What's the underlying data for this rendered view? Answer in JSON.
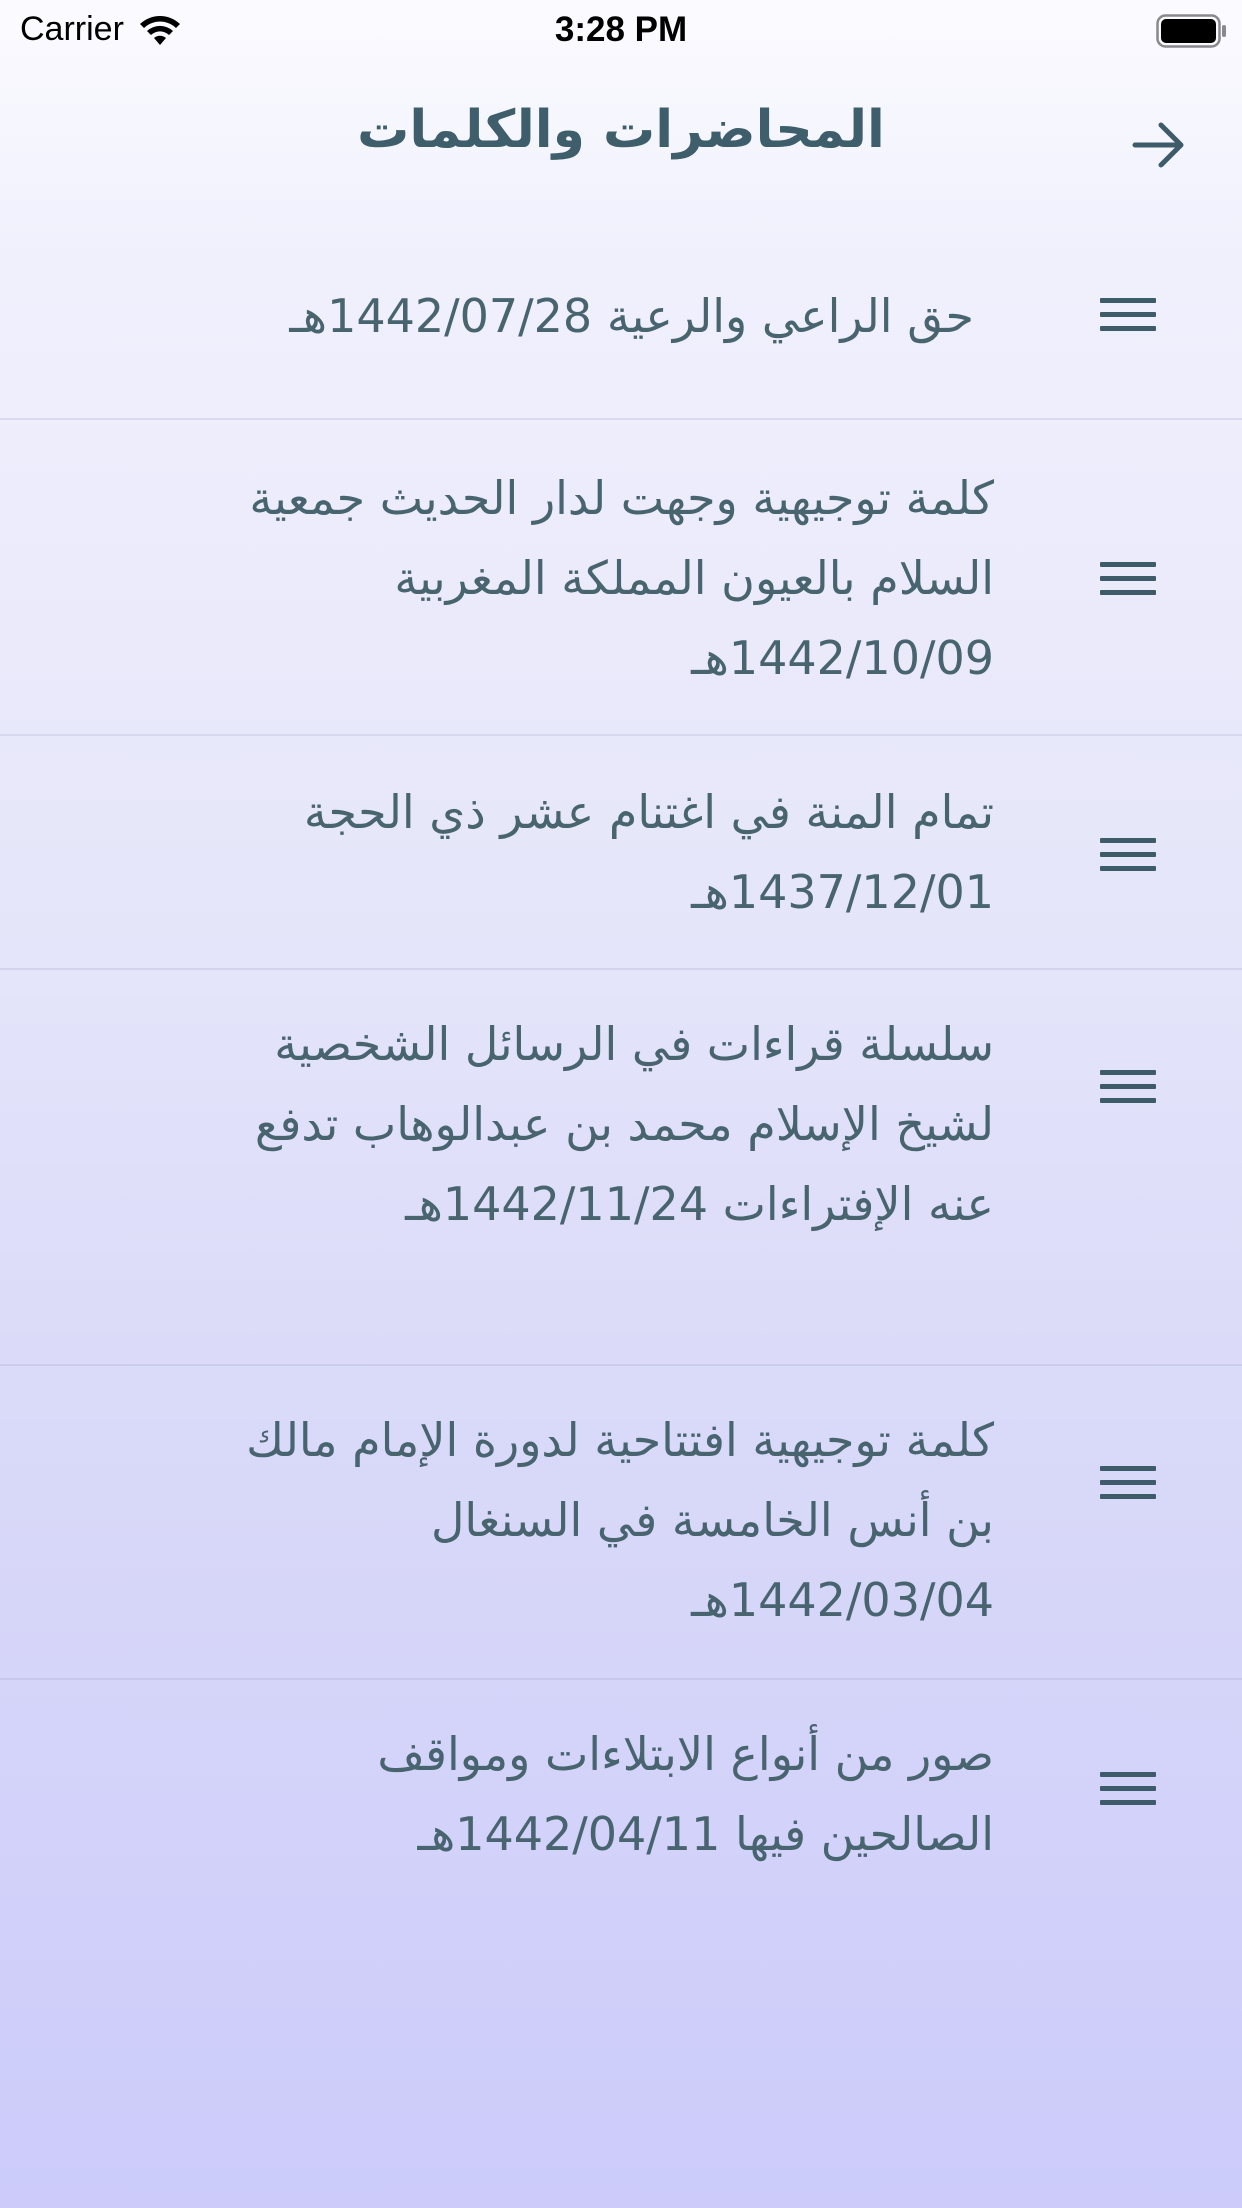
{
  "status_bar": {
    "carrier": "Carrier",
    "time": "3:28 PM",
    "icons": [
      "wifi-icon",
      "battery-icon"
    ]
  },
  "nav": {
    "title": "المحاضرات والكلمات",
    "back_icon": "arrow-right-icon"
  },
  "lectures": [
    {
      "title": "حق الراعي والرعية 1442/07/28هـ",
      "icon": "menu-icon"
    },
    {
      "title": " كلمة توجيهية وجهت لدار الحديث جمعية السلام بالعيون المملكة المغربية 1442/10/09هـ",
      "icon": "menu-icon"
    },
    {
      "title": "تمام المنة في اغتنام عشر ذي الحجة 1437/12/01هـ",
      "icon": "menu-icon"
    },
    {
      "title": "سلسلة قراءات في الرسائل الشخصية لشيخ الإسلام محمد بن عبدالوهاب تدفع عنه الإفتراءات 1442/11/24هـ",
      "icon": "menu-icon"
    },
    {
      "title": "كلمة توجيهية افتتاحية لدورة الإمام مالك بن أنس الخامسة في السنغال 1442/03/04هـ",
      "icon": "menu-icon"
    },
    {
      "title": " صور من أنواع الابتلاءات ومواقف الصالحين فيها 1442/04/11هـ",
      "icon": "menu-icon"
    }
  ],
  "colors": {
    "accent": "#3d5b68",
    "text": "#48646f",
    "background_top": "#fbfbff",
    "background_bottom": "#cccbfa"
  }
}
